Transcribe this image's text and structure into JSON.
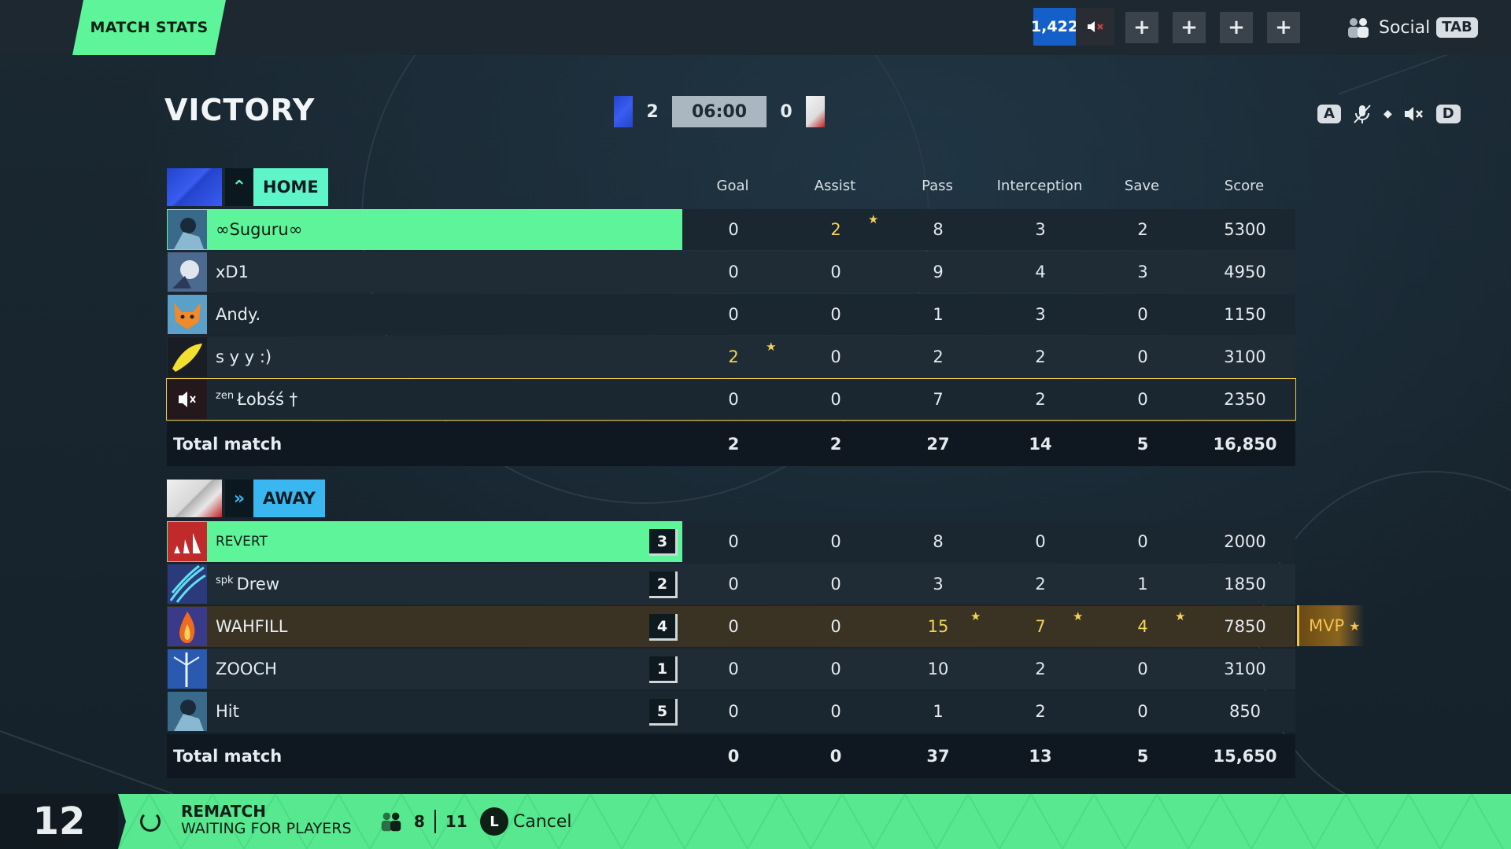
{
  "topbar": {
    "tab_label": "MATCH STATS",
    "currency": "1,422",
    "social_label": "Social",
    "social_key": "TAB"
  },
  "header": {
    "result": "VICTORY",
    "home_score": "2",
    "timer": "06:00",
    "away_score": "0",
    "key_left": "A",
    "key_right": "D"
  },
  "columns": [
    "Goal",
    "Assist",
    "Pass",
    "Interception",
    "Save",
    "Score"
  ],
  "home": {
    "team_name": "HOME",
    "players": [
      {
        "prefix": "",
        "name": "∞Suguru∞",
        "stats": [
          "0",
          "2",
          "8",
          "3",
          "2",
          "5300"
        ]
      },
      {
        "prefix": "",
        "name": "xD1",
        "stats": [
          "0",
          "0",
          "9",
          "4",
          "3",
          "4950"
        ]
      },
      {
        "prefix": "",
        "name": "Andy.",
        "stats": [
          "0",
          "0",
          "1",
          "3",
          "0",
          "1150"
        ]
      },
      {
        "prefix": "",
        "name": "s y y :)",
        "stats": [
          "2",
          "0",
          "2",
          "2",
          "0",
          "3100"
        ]
      },
      {
        "prefix": "zen",
        "name": "Łobśś †",
        "stats": [
          "0",
          "0",
          "7",
          "2",
          "0",
          "2350"
        ]
      }
    ],
    "total_label": "Total match",
    "totals": [
      "2",
      "2",
      "27",
      "14",
      "5",
      "16,850"
    ]
  },
  "away": {
    "team_name": "AWAY",
    "players": [
      {
        "prefix": "",
        "name": "REVERT",
        "rank": "3",
        "stats": [
          "0",
          "0",
          "8",
          "0",
          "0",
          "2000"
        ]
      },
      {
        "prefix": "spk",
        "name": "Drew",
        "rank": "2",
        "stats": [
          "0",
          "0",
          "3",
          "2",
          "1",
          "1850"
        ]
      },
      {
        "prefix": "",
        "name": "WAHFILL",
        "rank": "4",
        "stats": [
          "0",
          "0",
          "15",
          "7",
          "4",
          "7850"
        ]
      },
      {
        "prefix": "",
        "name": "ZOOCH",
        "rank": "1",
        "stats": [
          "0",
          "0",
          "10",
          "2",
          "0",
          "3100"
        ]
      },
      {
        "prefix": "",
        "name": "Hit",
        "rank": "5",
        "stats": [
          "0",
          "0",
          "1",
          "2",
          "0",
          "850"
        ]
      }
    ],
    "total_label": "Total match",
    "totals": [
      "0",
      "0",
      "37",
      "13",
      "5",
      "15,650"
    ]
  },
  "mvp_label": "MVP",
  "bottom": {
    "countdown": "12",
    "rematch": "REMATCH",
    "waiting": "WAITING FOR PLAYERS",
    "ready_count": "8",
    "total_count": "11",
    "cancel_key": "L",
    "cancel_label": "Cancel"
  },
  "colors": {
    "accent_green": "#5ef59a",
    "home_blue": "#2a4ce0",
    "away_cyan": "#3ab7f0",
    "mvp_gold": "#f2c24a",
    "selected_outline": "#e8c84a"
  }
}
